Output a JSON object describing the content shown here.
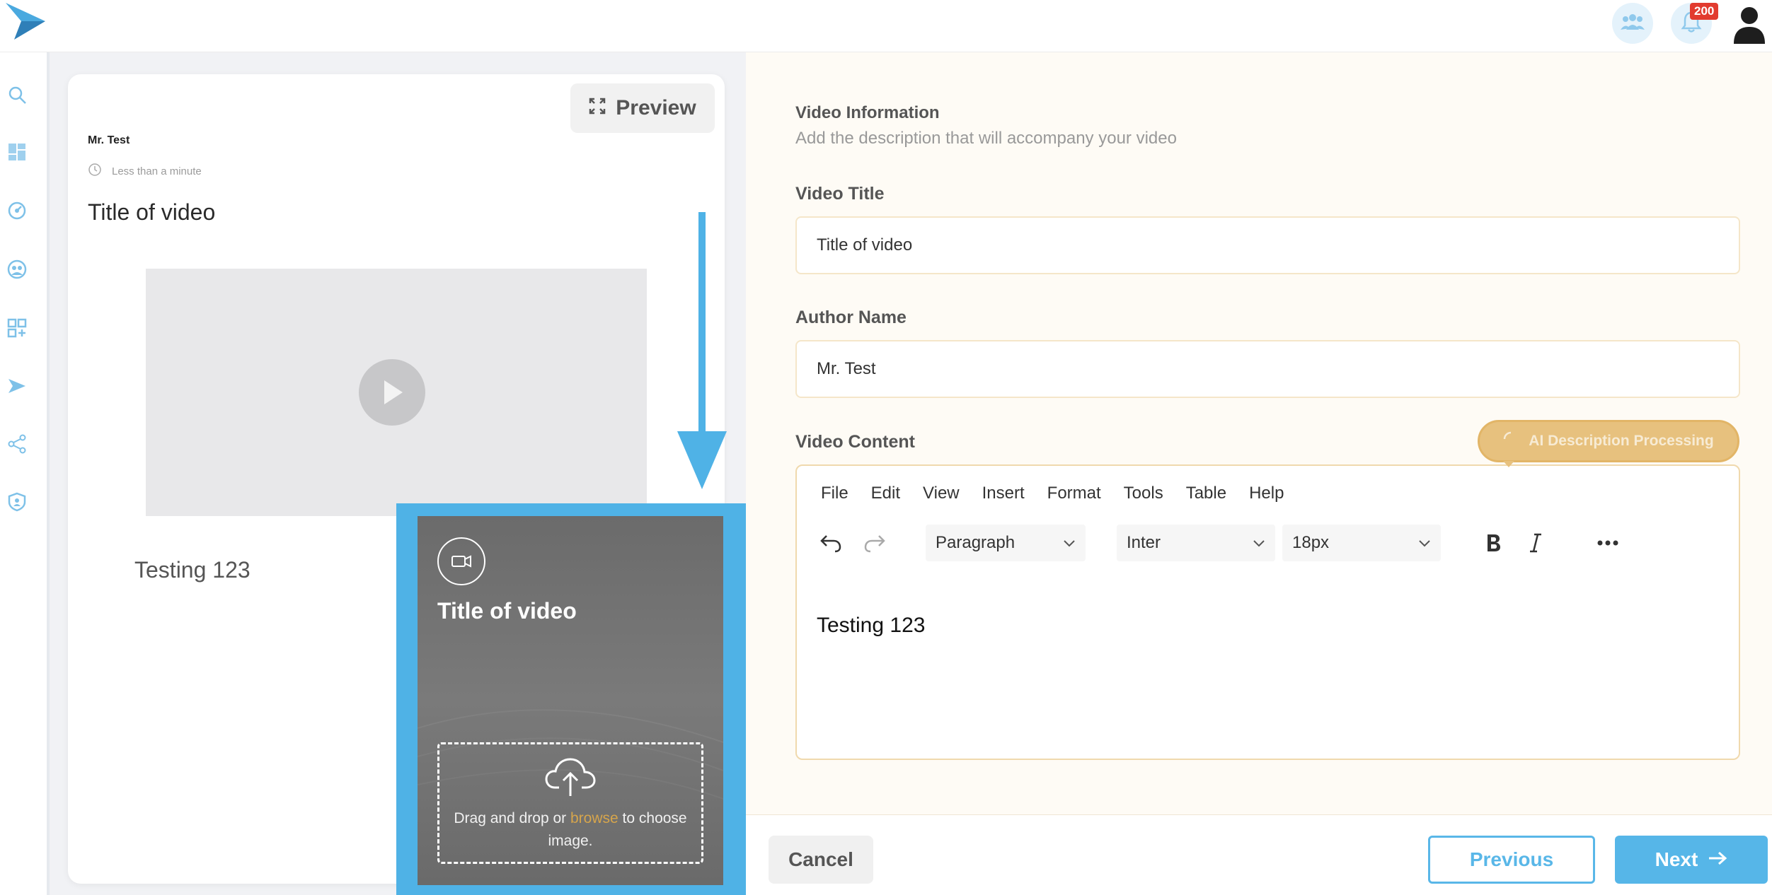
{
  "header": {
    "notifications_count": "200",
    "icons": [
      "logo-arrow-icon",
      "team-icon",
      "bell-icon",
      "user-icon"
    ]
  },
  "sidebar": {
    "icons": [
      "search-icon",
      "dashboard-icon",
      "dial-icon",
      "community-icon",
      "apps-add-icon",
      "send-icon",
      "share-icon",
      "shield-icon"
    ]
  },
  "preview": {
    "preview_button_label": "Preview",
    "author": "Mr. Test",
    "read_time": "Less than a minute",
    "title": "Title of video",
    "description": "Testing 123"
  },
  "thumbnail": {
    "title": "Title of video",
    "upload_text_before": "Drag and drop or ",
    "upload_link": "browse",
    "upload_text_after": " to choose image."
  },
  "form": {
    "section_title": "Video Information",
    "section_subtitle": "Add the description that will accompany your video",
    "video_title_label": "Video Title",
    "video_title_value": "Title of video",
    "author_label": "Author Name",
    "author_value": "Mr. Test",
    "content_label": "Video Content",
    "ai_button_label": "AI Description Processing"
  },
  "editor": {
    "menu": [
      "File",
      "Edit",
      "View",
      "Insert",
      "Format",
      "Tools",
      "Table",
      "Help"
    ],
    "block_format": "Paragraph",
    "font_family": "Inter",
    "font_size": "18px",
    "content": "Testing 123"
  },
  "footer": {
    "cancel_label": "Cancel",
    "previous_label": "Previous",
    "next_label": "Next"
  },
  "colors": {
    "accent_blue": "#56b6e8",
    "accent_gold": "#e2b567"
  }
}
